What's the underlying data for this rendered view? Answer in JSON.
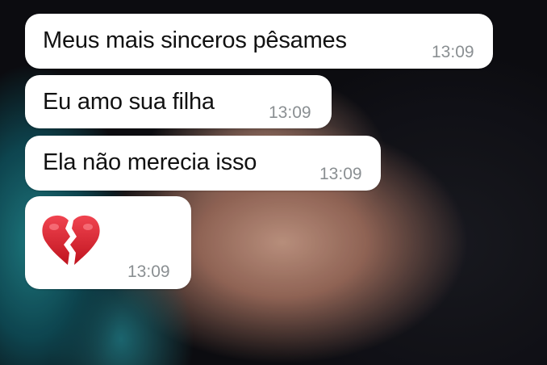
{
  "messages": [
    {
      "text": "Meus mais sinceros pêsames",
      "time": "13:09"
    },
    {
      "text": "Eu amo sua filha",
      "time": "13:09"
    },
    {
      "text": "Ela não merecia isso",
      "time": "13:09"
    },
    {
      "emoji": "broken-heart-icon",
      "time": "13:09"
    }
  ],
  "colors": {
    "bubble": "#ffffff",
    "text": "#111111",
    "timestamp": "#8a8f92",
    "heart": "#d8202b"
  }
}
